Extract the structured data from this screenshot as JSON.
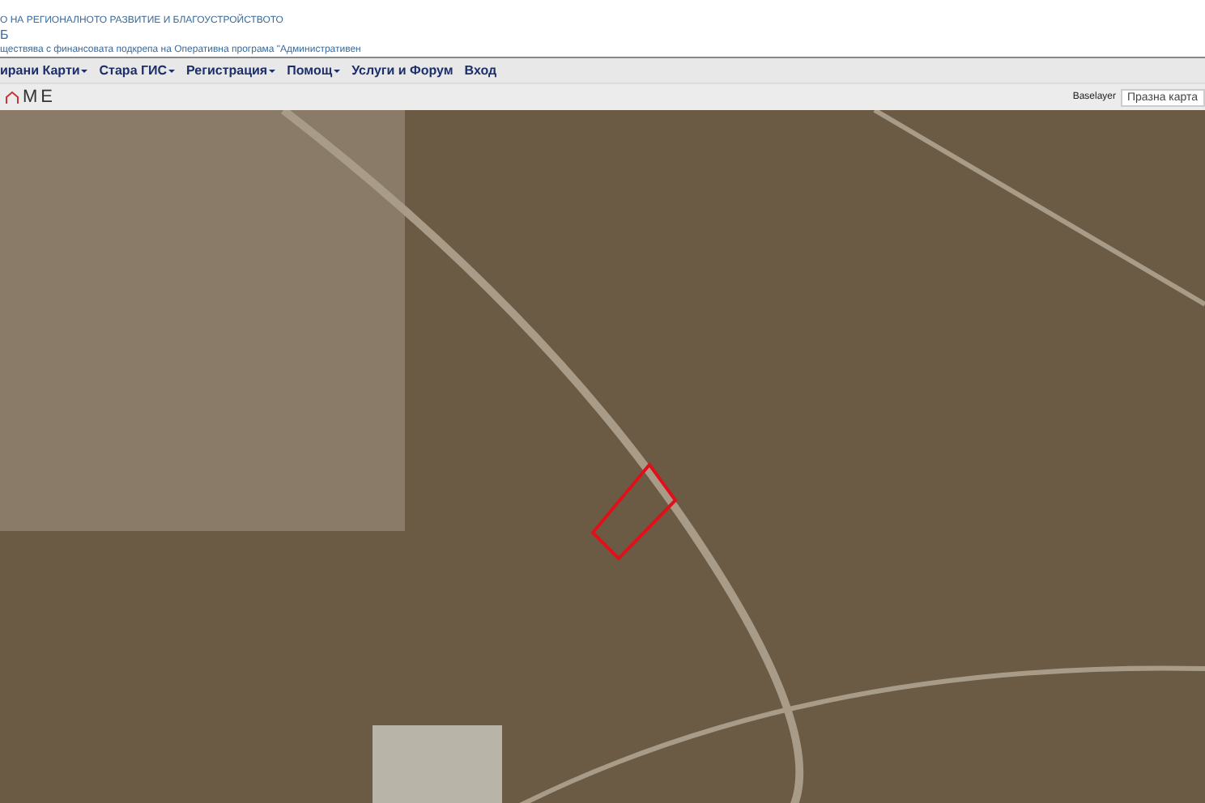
{
  "header": {
    "lines": [
      "О НА РЕГИОНАЛНОТО РАЗВИТИЕ И БЛАГОУСТРОЙСТВОТО",
      "Б",
      "ществява с финансовата подкрепа на Оперативна програма \"Административен"
    ]
  },
  "menu": [
    {
      "label": "ирани Карти",
      "dropdown": true
    },
    {
      "label": "Стара ГИС",
      "dropdown": true
    },
    {
      "label": "Регистрация",
      "dropdown": true
    },
    {
      "label": "Помощ",
      "dropdown": true
    },
    {
      "label": "Услуги и Форум",
      "dropdown": false
    },
    {
      "label": "Вход",
      "dropdown": false
    }
  ],
  "toolbar": {
    "logo": "ME",
    "baselayer_label": "Baselayer",
    "baselayer_value": "Празна карта"
  }
}
